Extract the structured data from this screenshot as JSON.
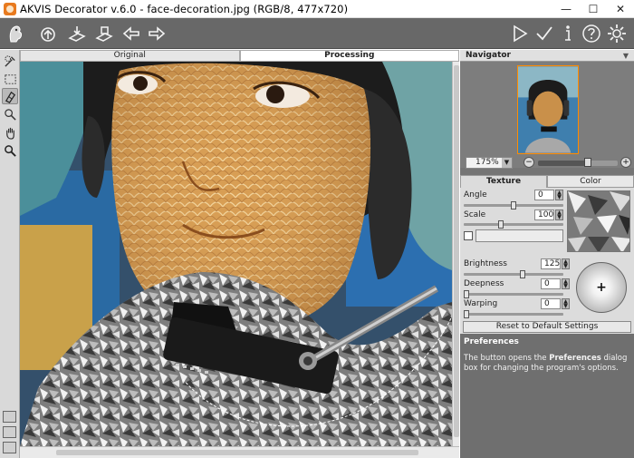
{
  "window": {
    "title": "AKVIS Decorator v.6.0 - face-decoration.jpg (RGB/8, 477x720)",
    "minimize": "—",
    "maximize": "☐",
    "close": "✕"
  },
  "toolbar": {
    "left_icons": [
      "app-logo-icon",
      "open-image-icon",
      "save-image-icon",
      "print-image-icon",
      "undo-icon",
      "redo-icon"
    ],
    "right_icons": [
      "run-icon",
      "apply-icon",
      "info-icon",
      "help-icon",
      "preferences-icon"
    ]
  },
  "left_tools": [
    "selection-brush-icon",
    "rectangle-selection-icon",
    "eraser-icon",
    "magic-tube-icon",
    "hand-icon",
    "zoom-icon"
  ],
  "image_tabs": {
    "original": "Original",
    "processing": "Processing"
  },
  "navigator": {
    "title": "Navigator",
    "zoom": "175%",
    "zoom_slider_fraction": 0.6
  },
  "settings": {
    "tabs": {
      "texture": "Texture",
      "color": "Color"
    },
    "angle_label": "Angle",
    "angle_value": "0",
    "scale_label": "Scale",
    "scale_value": "100",
    "brightness_label": "Brightness",
    "brightness_value": "125",
    "deepness_label": "Deepness",
    "deepness_value": "0",
    "warping_label": "Warping",
    "warping_value": "0",
    "light_center": "+",
    "reset_button": "Reset to Default Settings"
  },
  "help": {
    "title": "Preferences",
    "text_before": "The button opens the ",
    "text_bold": "Preferences",
    "text_after": " dialog box for changing the program's options."
  }
}
